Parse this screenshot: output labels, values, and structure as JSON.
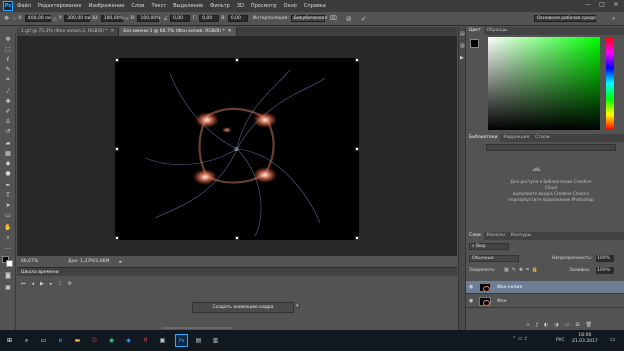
{
  "app": {
    "logo": "Ps"
  },
  "menu": [
    "Файл",
    "Редактирование",
    "Изображение",
    "Слои",
    "Текст",
    "Выделение",
    "Фильтр",
    "3D",
    "Просмотр",
    "Окно",
    "Справка"
  ],
  "window_controls": {
    "minimize": "—",
    "maximize": "□",
    "close": "✕"
  },
  "options": {
    "x_label": "X:",
    "x_value": "400,00 пи",
    "y_label": "Y:",
    "y_value": "300,00 пи",
    "w_label": "Ш:",
    "w_value": "100,00%",
    "h_label": "В:",
    "h_value": "100,00%",
    "angle_value": "0,00",
    "hskew_label": "Г:",
    "hskew_value": "0,00",
    "vskew_label": "В:",
    "vskew_value": "0,00",
    "interp_label": "Интерполяция:",
    "interp_value": "Бикубическая",
    "workspace": "Основная рабочая среда"
  },
  "doc_tabs": [
    {
      "label": "1.gif @ 75,3% (Фон копия 2, RGB/8) *",
      "active": false
    },
    {
      "label": "Без имени-1 @ 66,7% (Фон копия, RGB/8) *",
      "active": true
    }
  ],
  "status": {
    "zoom": "66,67%",
    "doc_info": "Док: 1,37M/2,66M"
  },
  "timeline": {
    "title": "Шкала времени",
    "create_button": "Создать анимацию кадра"
  },
  "color_panel": {
    "tabs": [
      "Цвет",
      "Образцы"
    ]
  },
  "libraries_panel": {
    "tabs": [
      "Библиотеки",
      "Коррекция",
      "Стили"
    ],
    "message_1": "Для доступа к библиотекам Creative Cloud",
    "message_2": "выполните вход в Creative Cloud и перезапустите приложение Photoshop"
  },
  "layers_panel": {
    "tabs": [
      "Слои",
      "Каналы",
      "Контуры"
    ],
    "filter_label": "Вид",
    "blend_mode": "Обычные",
    "opacity_label": "Непрозрачность:",
    "opacity_value": "100%",
    "lock_label": "Закрепить:",
    "fill_label": "Заливка:",
    "fill_value": "100%",
    "layers": [
      {
        "name": "Фон копия",
        "selected": true
      },
      {
        "name": "Фон",
        "selected": false
      }
    ]
  },
  "taskbar": {
    "lang": "РУС",
    "time": "18:06",
    "date": "21.03.2017"
  },
  "colors": {
    "accent": "#31a8ff",
    "selected_layer": "#6d7d95"
  }
}
